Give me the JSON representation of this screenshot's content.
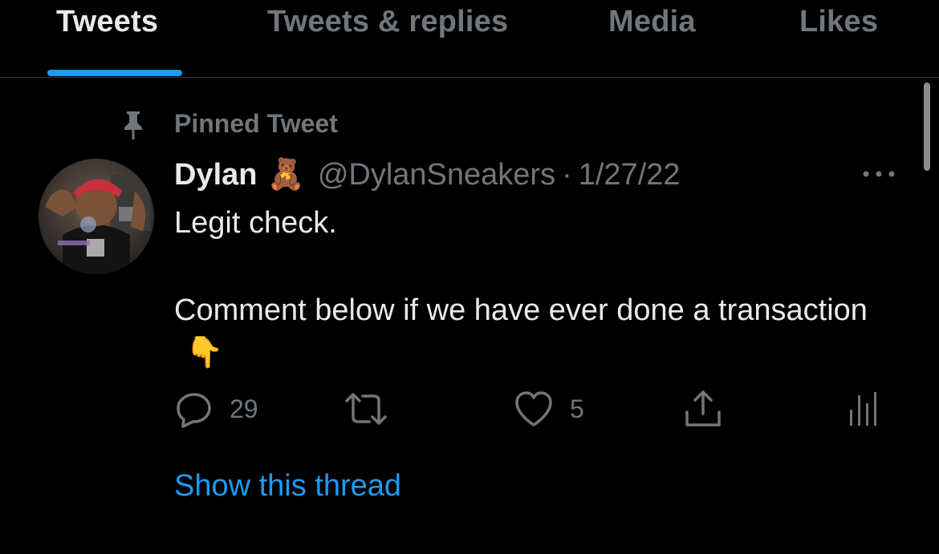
{
  "tabs": [
    {
      "label": "Tweets",
      "active": true
    },
    {
      "label": "Tweets & replies",
      "active": false
    },
    {
      "label": "Media",
      "active": false
    },
    {
      "label": "Likes",
      "active": false
    }
  ],
  "pinned": {
    "icon": "pin-icon",
    "label": "Pinned Tweet"
  },
  "tweet": {
    "display_name": "Dylan",
    "name_emoji": "🧸",
    "handle": "@DylanSneakers",
    "separator": "·",
    "date": "1/27/22",
    "text_line1": "Legit check.",
    "text_line2": "Comment below if we have ever done a transaction",
    "text_emoji": "👇",
    "actions": {
      "reply_count": "29",
      "retweet_count": "",
      "like_count": "5"
    },
    "show_thread": "Show this thread"
  },
  "colors": {
    "background": "#000000",
    "primary_text": "#e7e9ea",
    "secondary_text": "#71767b",
    "accent": "#1d9bf0",
    "divider": "#2f3336"
  }
}
